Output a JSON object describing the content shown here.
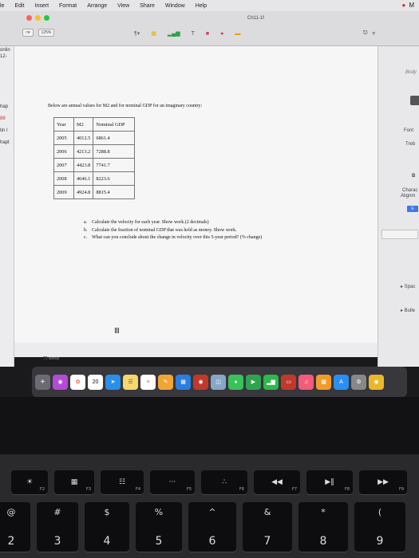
{
  "menubar": {
    "items": [
      "le",
      "Edit",
      "Insert",
      "Format",
      "Arrange",
      "View",
      "Share",
      "Window",
      "Help"
    ]
  },
  "toolbar": {
    "doc_title": "Ch11-1f",
    "zoom_value": "125%",
    "view_label": "□▾"
  },
  "sidebar_left": {
    "labels": [
      "onlin",
      "12-",
      "hap",
      "88",
      "tin I",
      "hapt"
    ]
  },
  "document": {
    "intro": "Below are annual values for M2 and for nominal GDP for an imaginary country:",
    "table": {
      "headers": [
        "Year",
        "M2",
        "Nominal GDP"
      ],
      "rows": [
        [
          "2005",
          "4012.5",
          "6861.4"
        ],
        [
          "2006",
          "4213.2",
          "7288.8"
        ],
        [
          "2007",
          "4423.8",
          "7741.7"
        ],
        [
          "2008",
          "4646.1",
          "8223.6"
        ],
        [
          "2009",
          "4924.8",
          "8815.4"
        ]
      ]
    },
    "questions": [
      {
        "n": "a.",
        "text": "Calculate the velocity for each year. Show work.(2 decimals)"
      },
      {
        "n": "b.",
        "text": "Calculate the fraction of nominal GDP that was held as money. Show work."
      },
      {
        "n": "c.",
        "text": "What can you conclude about the change in velocity over this 5-year period? (% change)"
      }
    ]
  },
  "status": {
    "word_count": "71",
    "words_label": "words"
  },
  "inspector": {
    "body": "Body",
    "font": "Font",
    "font_name": "Treb",
    "bold_b": "B",
    "character": "Charac",
    "alignment": "Alignm",
    "align_btn": "E",
    "spacing": "▸ Spac",
    "bullets": "▸ Bulle"
  },
  "dock": {
    "calendar_day": "20"
  },
  "keyboard": {
    "fn_keys": [
      {
        "icon": "☀",
        "label": "F2"
      },
      {
        "icon": "▦",
        "label": "F3"
      },
      {
        "icon": "☷",
        "label": "F4"
      },
      {
        "icon": "···",
        "label": "F5"
      },
      {
        "icon": "∴",
        "label": "F6"
      },
      {
        "icon": "◀◀",
        "label": "F7"
      },
      {
        "icon": "▶‖",
        "label": "F8"
      },
      {
        "icon": "▶▶",
        "label": "F9"
      }
    ],
    "num_keys": [
      {
        "top": "@",
        "bottom": "2"
      },
      {
        "top": "#",
        "bottom": "3"
      },
      {
        "top": "$",
        "bottom": "4"
      },
      {
        "top": "%",
        "bottom": "5"
      },
      {
        "top": "^",
        "bottom": "6"
      },
      {
        "top": "&",
        "bottom": "7"
      },
      {
        "top": "*",
        "bottom": "8"
      },
      {
        "top": "(",
        "bottom": "9"
      }
    ]
  },
  "colors": {
    "traffic_red": "#fe5f57",
    "traffic_yellow": "#febc2e",
    "traffic_green": "#28c840",
    "accent_blue": "#3b7be8"
  }
}
